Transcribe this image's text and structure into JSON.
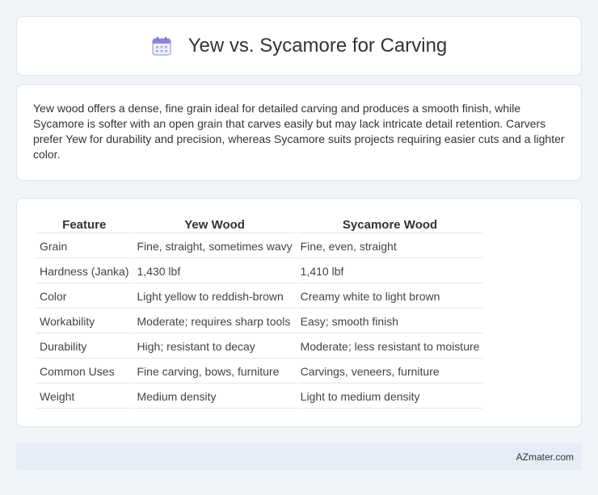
{
  "header": {
    "icon": "calendar-icon",
    "title": "Yew vs. Sycamore for Carving"
  },
  "intro": {
    "text": "Yew wood offers a dense, fine grain ideal for detailed carving and produces a smooth finish, while Sycamore is softer with an open grain that carves easily but may lack intricate detail retention. Carvers prefer Yew for durability and precision, whereas Sycamore suits projects requiring easier cuts and a lighter color."
  },
  "table": {
    "headers": [
      "Feature",
      "Yew Wood",
      "Sycamore Wood"
    ],
    "rows": [
      [
        "Grain",
        "Fine, straight, sometimes wavy",
        "Fine, even, straight"
      ],
      [
        "Hardness (Janka)",
        "1,430 lbf",
        "1,410 lbf"
      ],
      [
        "Color",
        "Light yellow to reddish-brown",
        "Creamy white to light brown"
      ],
      [
        "Workability",
        "Moderate; requires sharp tools",
        "Easy; smooth finish"
      ],
      [
        "Durability",
        "High; resistant to decay",
        "Moderate; less resistant to moisture"
      ],
      [
        "Common Uses",
        "Fine carving, bows, furniture",
        "Carvings, veneers, furniture"
      ],
      [
        "Weight",
        "Medium density",
        "Light to medium density"
      ]
    ]
  },
  "footer": {
    "text": "AZmater.com"
  },
  "colors": {
    "background": "#f1f4f9",
    "card": "#ffffff",
    "footer": "#e6edf7",
    "icon_accent": "#7b6fd0"
  }
}
